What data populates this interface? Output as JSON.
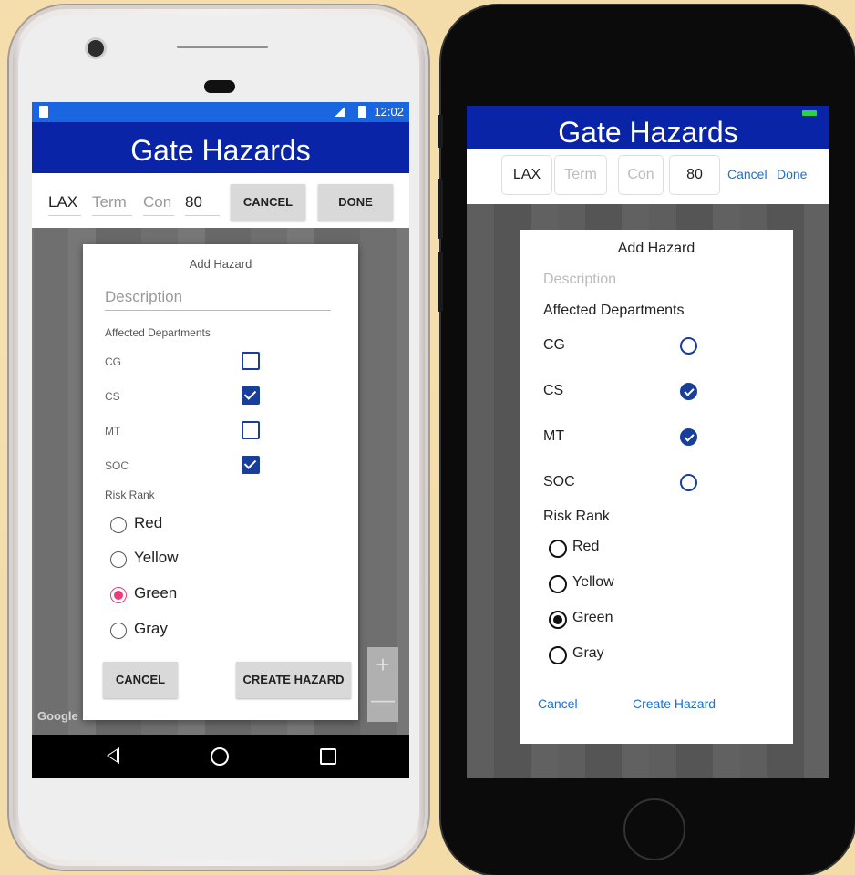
{
  "android": {
    "status": {
      "time": "12:02"
    },
    "title": "Gate Hazards",
    "toolbar": {
      "station": "LAX",
      "term_placeholder": "Term",
      "con_placeholder": "Con",
      "gate": "80",
      "cancel": "CANCEL",
      "done": "DONE"
    },
    "map": {
      "attribution": "Google",
      "zoom_in": "+",
      "zoom_out": "—"
    },
    "dialog": {
      "title": "Add Hazard",
      "description_placeholder": "Description",
      "departments_label": "Affected Departments",
      "departments": [
        {
          "name": "CG",
          "checked": false
        },
        {
          "name": "CS",
          "checked": true
        },
        {
          "name": "MT",
          "checked": false
        },
        {
          "name": "SOC",
          "checked": true
        }
      ],
      "risk_label": "Risk Rank",
      "risks": [
        {
          "name": "Red",
          "selected": false
        },
        {
          "name": "Yellow",
          "selected": false
        },
        {
          "name": "Green",
          "selected": true
        },
        {
          "name": "Gray",
          "selected": false
        }
      ],
      "cancel": "CANCEL",
      "create": "CREATE HAZARD"
    },
    "colors": {
      "title_bar": "#0a24a8",
      "status_bar": "#1a66e0",
      "checkbox": "#183e9c",
      "radio_selected": "#e83e77"
    }
  },
  "ios": {
    "title": "Gate Hazards",
    "toolbar": {
      "station": "LAX",
      "term_placeholder": "Term",
      "con_placeholder": "Con",
      "gate": "80",
      "cancel": "Cancel",
      "done": "Done"
    },
    "dialog": {
      "title": "Add Hazard",
      "description_placeholder": "Description",
      "departments_label": "Affected Departments",
      "departments": [
        {
          "name": "CG",
          "checked": false
        },
        {
          "name": "CS",
          "checked": true
        },
        {
          "name": "MT",
          "checked": true
        },
        {
          "name": "SOC",
          "checked": false
        }
      ],
      "risk_label": "Risk Rank",
      "risks": [
        {
          "name": "Red",
          "selected": false
        },
        {
          "name": "Yellow",
          "selected": false
        },
        {
          "name": "Green",
          "selected": true
        },
        {
          "name": "Gray",
          "selected": false
        }
      ],
      "cancel": "Cancel",
      "create": "Create Hazard"
    },
    "colors": {
      "title_bar": "#0a24a8",
      "link": "#1b6fd6",
      "checkbox": "#183e9c"
    }
  }
}
